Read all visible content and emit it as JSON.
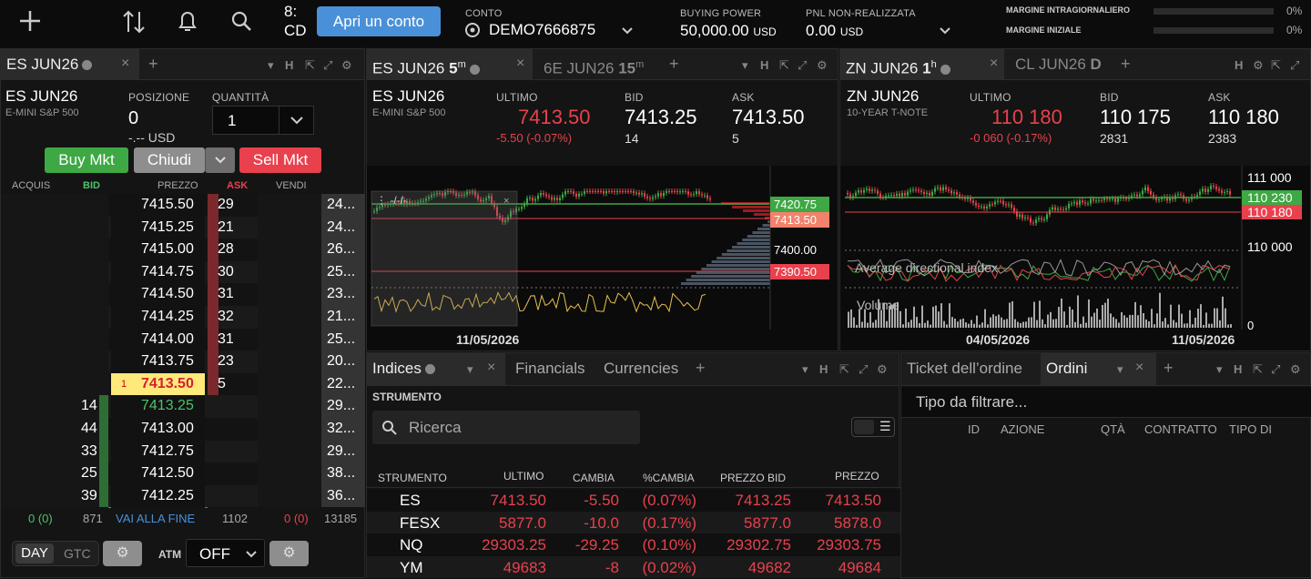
{
  "top": {
    "icons": [
      "plus-icon",
      "sort-icon",
      "bell-icon",
      "search-icon"
    ],
    "clipped_text_1": "8:",
    "clipped_text_2": "CD",
    "cta": "Apri un conto",
    "account_label": "CONTO",
    "account_value": "DEMO7666875",
    "bp_label": "BUYING POWER",
    "bp_value": "50,000.00",
    "bp_unit": "USD",
    "pnl_label": "PNL NON-REALIZZATA",
    "pnl_value": "0.00",
    "pnl_unit": "USD",
    "m1_label": "MARGINE INTRAGIORNALIERO",
    "m1_value": "0%",
    "m2_label": "MARGINE INIZIALE",
    "m2_value": "0%"
  },
  "dom": {
    "tab": "ES JUN26",
    "symbol": "ES JUN26",
    "desc": "E-MINI S&P 500",
    "pos_label": "POSIZIONE",
    "pos_value": "0",
    "pos_usd": "-.-- USD",
    "qty_label": "QUANTITÀ",
    "qty_value": "1",
    "buy": "Buy Mkt",
    "close": "Chiudi",
    "sell": "Sell Mkt",
    "headers": [
      "ACQUIS",
      "BID",
      "PREZZO",
      "ASK",
      "VENDI"
    ],
    "rows": [
      {
        "bid": "",
        "price": "7415.50",
        "ask": "29",
        "sell": "24..."
      },
      {
        "bid": "",
        "price": "7415.25",
        "ask": "21",
        "sell": "24..."
      },
      {
        "bid": "",
        "price": "7415.00",
        "ask": "28",
        "sell": "26..."
      },
      {
        "bid": "",
        "price": "7414.75",
        "ask": "30",
        "sell": "25..."
      },
      {
        "bid": "",
        "price": "7414.50",
        "ask": "31",
        "sell": "23..."
      },
      {
        "bid": "",
        "price": "7414.25",
        "ask": "32",
        "sell": "21..."
      },
      {
        "bid": "",
        "price": "7414.00",
        "ask": "31",
        "sell": "25..."
      },
      {
        "bid": "",
        "price": "7413.75",
        "ask": "23",
        "sell": "20..."
      },
      {
        "bid": "",
        "price": "7413.50",
        "ask": "5",
        "sell": "22...",
        "last": "1"
      },
      {
        "bid": "14",
        "price": "7413.25",
        "ask": "",
        "sell": "29..."
      },
      {
        "bid": "44",
        "price": "7413.00",
        "ask": "",
        "sell": "32..."
      },
      {
        "bid": "33",
        "price": "7412.75",
        "ask": "",
        "sell": "29..."
      },
      {
        "bid": "25",
        "price": "7412.50",
        "ask": "",
        "sell": "38..."
      },
      {
        "bid": "39",
        "price": "7412.25",
        "ask": "",
        "sell": "36..."
      }
    ],
    "footer": {
      "a": "0 (0)",
      "b": "871",
      "c": "VAI ALLA FINE",
      "d": "1102",
      "e": "0 (0)",
      "f": "13185"
    },
    "day": "DAY",
    "gtc": "GTC",
    "atm": "ATM",
    "off": "OFF"
  },
  "es": {
    "tab1": "ES JUN26",
    "tab1_tf": "5",
    "tab1_unit": "m",
    "tab2": "6E JUN26",
    "tab2_tf": "15",
    "tab2_unit": "m",
    "symbol": "ES JUN26",
    "desc": "E-MINI S&P 500",
    "last_label": "ULTIMO",
    "last": "7413.50",
    "chg": "-5.50 (-0.07%)",
    "bid_label": "BID",
    "bid": "7413.25",
    "bid_size": "14",
    "ask_label": "ASK",
    "ask": "7413.50",
    "ask_size": "5",
    "p1": "7420.75",
    "p2": "7413.50",
    "p3": "7400.00",
    "p4": "7390.50",
    "date": "11/05/2026"
  },
  "zn": {
    "tab1": "ZN JUN26",
    "tab1_tf": "1",
    "tab1_unit": "h",
    "tab2": "CL JUN26",
    "tab2_tf": "D",
    "symbol": "ZN JUN26",
    "desc": "10-YEAR T-NOTE",
    "last_label": "ULTIMO",
    "last": "110 180",
    "chg": "-0 060 (-0.17%)",
    "bid_label": "BID",
    "bid": "110 175",
    "bid_size": "2831",
    "ask_label": "ASK",
    "ask": "110 180",
    "ask_size": "2383",
    "p1": "111 000",
    "p2": "110 230",
    "p3": "110 180",
    "p4": "110 000",
    "ind1": "Average directional index",
    "ind2": "Volume",
    "ind2_zero": "0",
    "date1": "04/05/2026",
    "date2": "11/05/2026"
  },
  "watch": {
    "tabs": [
      "Indices",
      "Financials",
      "Currencies"
    ],
    "strumento": "STRUMENTO",
    "search": "Ricerca",
    "headers": [
      "STRUMENTO",
      "ULTIMO",
      "CAMBIA",
      "%CAMBIA",
      "PREZZO BID",
      "PREZZO"
    ],
    "rows": [
      [
        "ES",
        "7413.50",
        "-5.50",
        "(0.07%)",
        "7413.25",
        "7413.50"
      ],
      [
        "FESX",
        "5877.0",
        "-10.0",
        "(0.17%)",
        "5877.0",
        "5878.0"
      ],
      [
        "NQ",
        "29303.25",
        "-29.25",
        "(0.10%)",
        "29302.75",
        "29303.75"
      ],
      [
        "YM",
        "49683",
        "-8",
        "(0.02%)",
        "49682",
        "49684"
      ]
    ]
  },
  "orders": {
    "tab1": "Ticket dell’ordine",
    "tab2": "Ordini",
    "filter": "Tipo da filtrare...",
    "headers": [
      "ID",
      "AZIONE",
      "QTÀ",
      "CONTRATTO",
      "TIPO DI"
    ]
  },
  "colors": {
    "buy": "#3ea844",
    "sell": "#e8414d",
    "cta": "#4a90d9",
    "highlight": "#ffe97a"
  }
}
